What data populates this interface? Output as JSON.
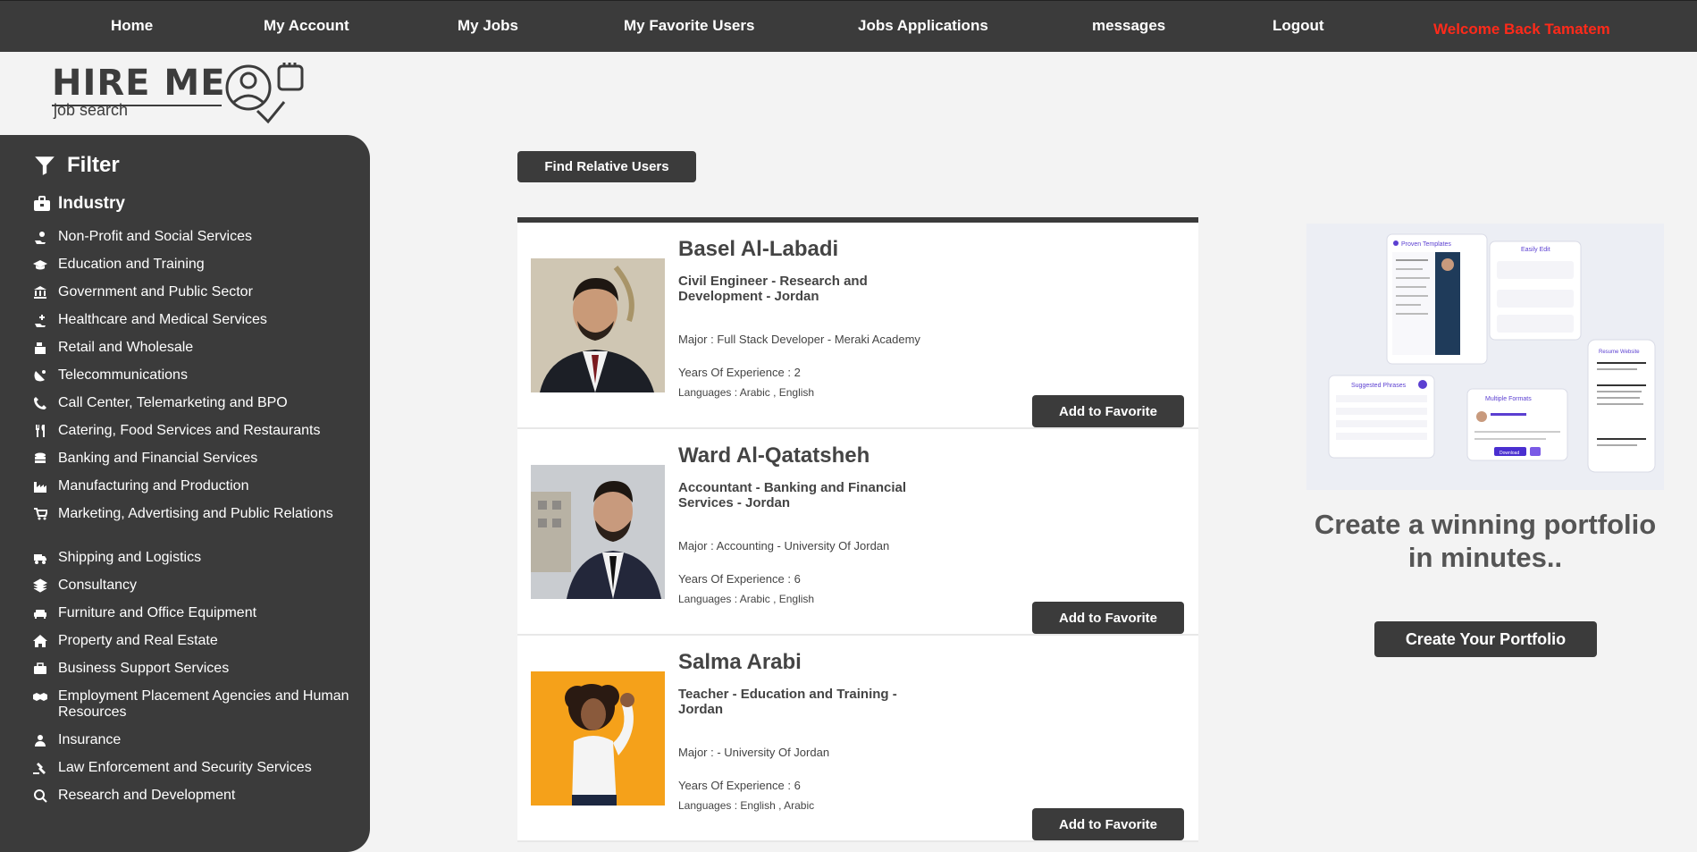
{
  "nav": {
    "home": "Home",
    "account": "My Account",
    "jobs": "My Jobs",
    "favorites": "My Favorite Users",
    "applications": "Jobs Applications",
    "messages": "messages",
    "logout": "Logout",
    "welcome": "Welcome Back Tamatem"
  },
  "logo": {
    "brand": "HIRE ME",
    "tagline": "job search"
  },
  "sidebar": {
    "filter_title": "Filter",
    "industry_title": "Industry",
    "items": [
      {
        "label": "Non-Profit and Social Services",
        "icon": "hand-holding-icon"
      },
      {
        "label": "Education and Training",
        "icon": "graduation-cap-icon"
      },
      {
        "label": "Government and Public Sector",
        "icon": "landmark-icon"
      },
      {
        "label": "Healthcare and Medical Services",
        "icon": "hand-holding-medical-icon"
      },
      {
        "label": "Retail and Wholesale",
        "icon": "cash-register-icon"
      },
      {
        "label": "Telecommunications",
        "icon": "satellite-dish-icon"
      },
      {
        "label": "Call Center, Telemarketing and BPO",
        "icon": "phone-icon"
      },
      {
        "label": "Catering, Food Services and Restaurants",
        "icon": "utensils-icon"
      },
      {
        "label": "Banking and Financial Services",
        "icon": "coins-icon"
      },
      {
        "label": "Manufacturing and Production",
        "icon": "industry-icon"
      },
      {
        "label": "Marketing, Advertising and Public Relations",
        "icon": "cart-icon"
      },
      {
        "label": "Shipping and Logistics",
        "icon": "truck-icon"
      },
      {
        "label": "Consultancy",
        "icon": "layers-icon"
      },
      {
        "label": "Furniture and Office Equipment",
        "icon": "couch-icon"
      },
      {
        "label": "Property and Real Estate",
        "icon": "home-icon"
      },
      {
        "label": "Business Support Services",
        "icon": "briefcase-icon"
      },
      {
        "label": "Employment Placement Agencies and Human Resources",
        "icon": "handshake-icon"
      },
      {
        "label": "Insurance",
        "icon": "user-shield-icon"
      },
      {
        "label": "Law Enforcement and Security Services",
        "icon": "gavel-icon"
      },
      {
        "label": "Research and Development",
        "icon": "search-icon"
      }
    ]
  },
  "main": {
    "find_button": "Find Relative Users",
    "users": [
      {
        "name": "Basel Al-Labadi",
        "title": "Civil Engineer - Research and Development - Jordan",
        "major": "Major : Full Stack Developer - Meraki Academy",
        "experience": "Years Of Experience : 2",
        "languages": "Languages : Arabic , English",
        "button": "Add to Favorite"
      },
      {
        "name": "Ward Al-Qatatsheh",
        "title": "Accountant - Banking and Financial Services - Jordan",
        "major": "Major : Accounting - University Of Jordan",
        "experience": "Years Of Experience : 6",
        "languages": "Languages : Arabic , English",
        "button": "Add to Favorite"
      },
      {
        "name": "Salma Arabi",
        "title": "Teacher - Education and Training - Jordan",
        "major": "Major : - University Of Jordan",
        "experience": "Years Of Experience : 6",
        "languages": "Languages : English , Arabic",
        "button": "Add to Favorite"
      }
    ]
  },
  "promo": {
    "heading": "Create a winning portfolio in minutes..",
    "button": "Create Your Portfolio",
    "mock": {
      "proven_templates": "Proven Templates",
      "easily_edit": "Easily Edit",
      "suggested_phrases": "Suggested Phrases",
      "multiple_formats": "Multiple Formats",
      "resume_website": "Resume Website",
      "download": "Download"
    }
  },
  "colors": {
    "nav_bg": "#3b3b3b",
    "welcome": "#ff2a1a",
    "accent_purple": "#5b3fd1"
  }
}
